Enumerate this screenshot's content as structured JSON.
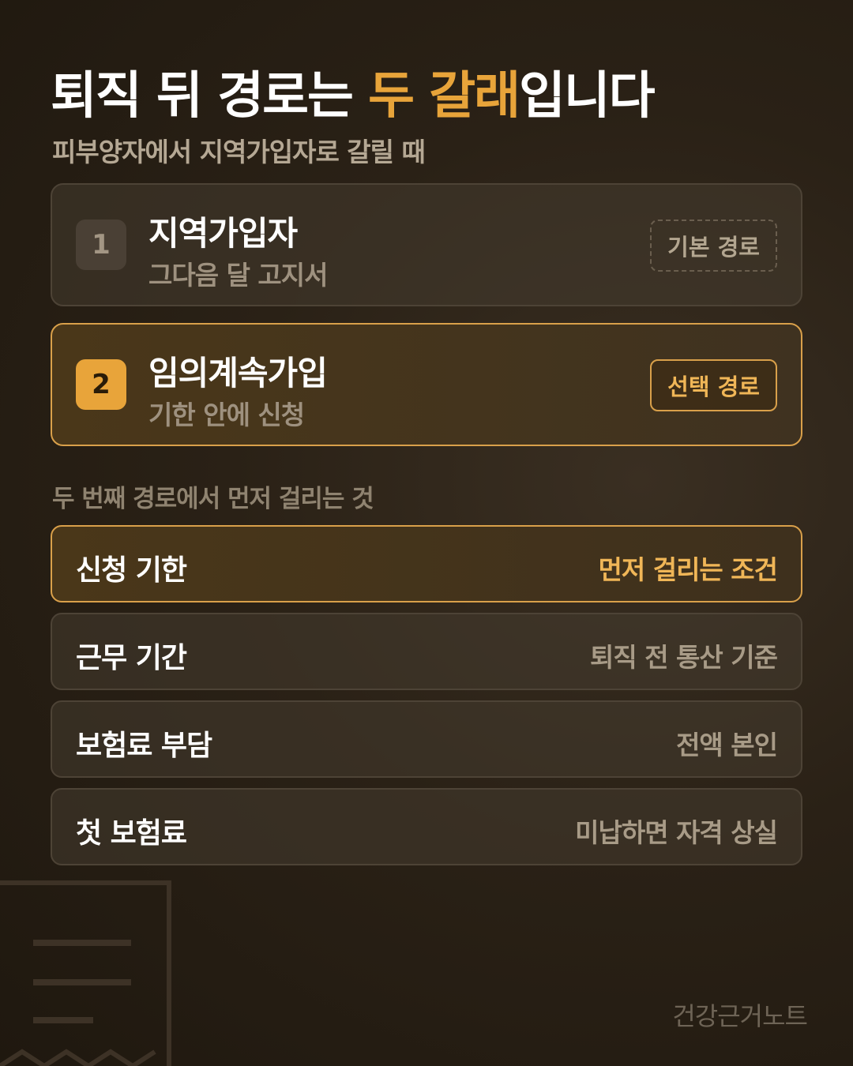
{
  "header": {
    "title_prefix": "퇴직 뒤 경로는 ",
    "title_highlight": "두 갈래",
    "title_suffix": "입니다",
    "subtitle": "피부양자에서 지역가입자로 갈릴 때"
  },
  "routes": [
    {
      "number": "1",
      "name": "지역가입자",
      "desc": "그다음 달 고지서",
      "tag": "기본 경로",
      "selected": false
    },
    {
      "number": "2",
      "name": "임의계속가입",
      "desc": "기한 안에 신청",
      "tag": "선택 경로",
      "selected": true
    }
  ],
  "conditions": {
    "label": "두 번째 경로에서 먼저 걸리는 것",
    "items": [
      {
        "name": "신청 기한",
        "value": "먼저 걸리는 조건",
        "highlighted": true
      },
      {
        "name": "근무 기간",
        "value": "퇴직 전 통산 기준",
        "highlighted": false
      },
      {
        "name": "보험료 부담",
        "value": "전액 본인",
        "highlighted": false
      },
      {
        "name": "첫 보험료",
        "value": "미납하면 자격 상실",
        "highlighted": false
      }
    ]
  },
  "footer": {
    "brand": "건강근거노트"
  },
  "colors": {
    "accent": "#e8a43a",
    "background": "#2a2116",
    "card": "#3a3128"
  },
  "icons": {
    "decoration": "document-icon"
  }
}
